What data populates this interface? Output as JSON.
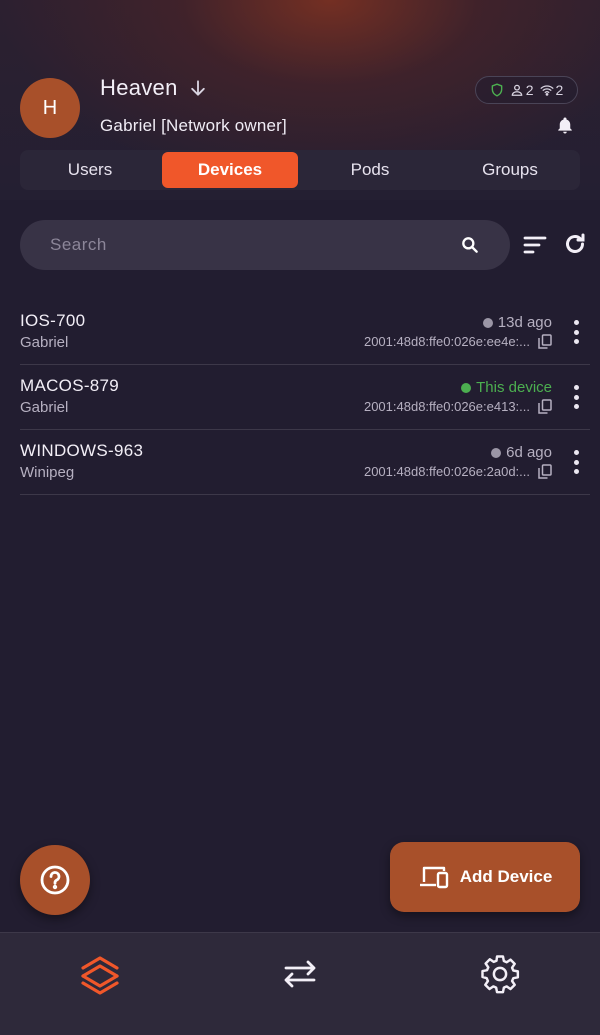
{
  "header": {
    "avatar_initial": "H",
    "network_name": "Heaven",
    "owner_label": "Gabriel [Network owner]",
    "stats": {
      "users": "2",
      "devices": "2"
    }
  },
  "tabs": [
    {
      "label": "Users",
      "active": false
    },
    {
      "label": "Devices",
      "active": true
    },
    {
      "label": "Pods",
      "active": false
    },
    {
      "label": "Groups",
      "active": false
    }
  ],
  "search": {
    "placeholder": "Search",
    "value": ""
  },
  "devices": [
    {
      "name": "IOS-700",
      "owner": "Gabriel",
      "status": "13d ago",
      "current": false,
      "address": "2001:48d8:ffe0:026e:ee4e:..."
    },
    {
      "name": "MACOS-879",
      "owner": "Gabriel",
      "status": "This device",
      "current": true,
      "address": "2001:48d8:ffe0:026e:e413:..."
    },
    {
      "name": "WINDOWS-963",
      "owner": "Winipeg",
      "status": "6d ago",
      "current": false,
      "address": "2001:48d8:ffe0:026e:2a0d:..."
    }
  ],
  "actions": {
    "add_device_label": "Add Device"
  },
  "bottom_nav": [
    {
      "icon": "network-layers-icon",
      "active": true
    },
    {
      "icon": "transfer-icon",
      "active": false
    },
    {
      "icon": "settings-gear-icon",
      "active": false
    }
  ],
  "colors": {
    "accent": "#f0572a",
    "button": "#a8502a",
    "background": "#221d30",
    "online": "#4caf50"
  }
}
